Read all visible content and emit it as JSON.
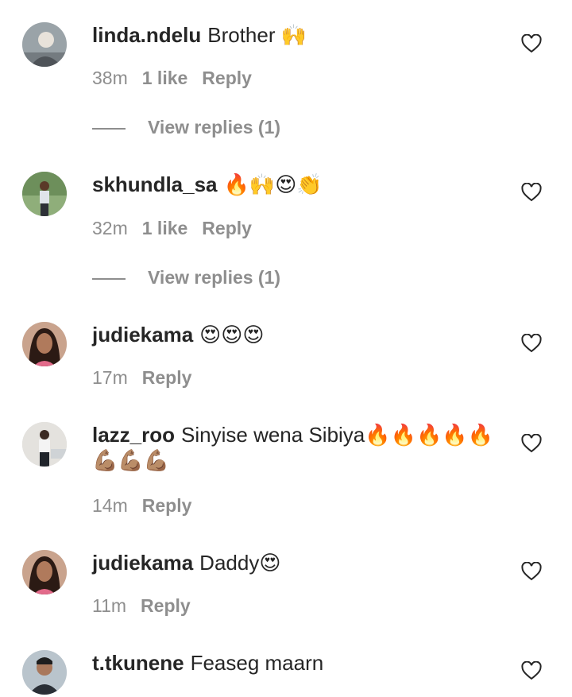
{
  "colors": {
    "primary_text": "#262626",
    "secondary_text": "#8e8e8e",
    "background": "#ffffff"
  },
  "comments": [
    {
      "username": "linda.ndelu",
      "text": "Brother 🙌",
      "time": "38m",
      "likes": "1 like",
      "reply": "Reply",
      "view_replies": "View replies (1)"
    },
    {
      "username": "skhundla_sa",
      "text": "🔥🙌😍👏",
      "time": "32m",
      "likes": "1 like",
      "reply": "Reply",
      "view_replies": "View replies (1)"
    },
    {
      "username": "judiekama",
      "text": "😍😍😍",
      "time": "17m",
      "reply": "Reply"
    },
    {
      "username": "lazz_roo",
      "text": "Sinyise wena Sibiya🔥🔥🔥🔥🔥 💪🏽💪🏽💪🏽",
      "time": "14m",
      "reply": "Reply"
    },
    {
      "username": "judiekama",
      "text": "Daddy😍",
      "time": "11m",
      "reply": "Reply"
    },
    {
      "username": "t.tkunene",
      "text": "Feaseg maarn"
    }
  ],
  "icons": {
    "like": "heart-outline-icon",
    "avatar": "user-avatar"
  }
}
